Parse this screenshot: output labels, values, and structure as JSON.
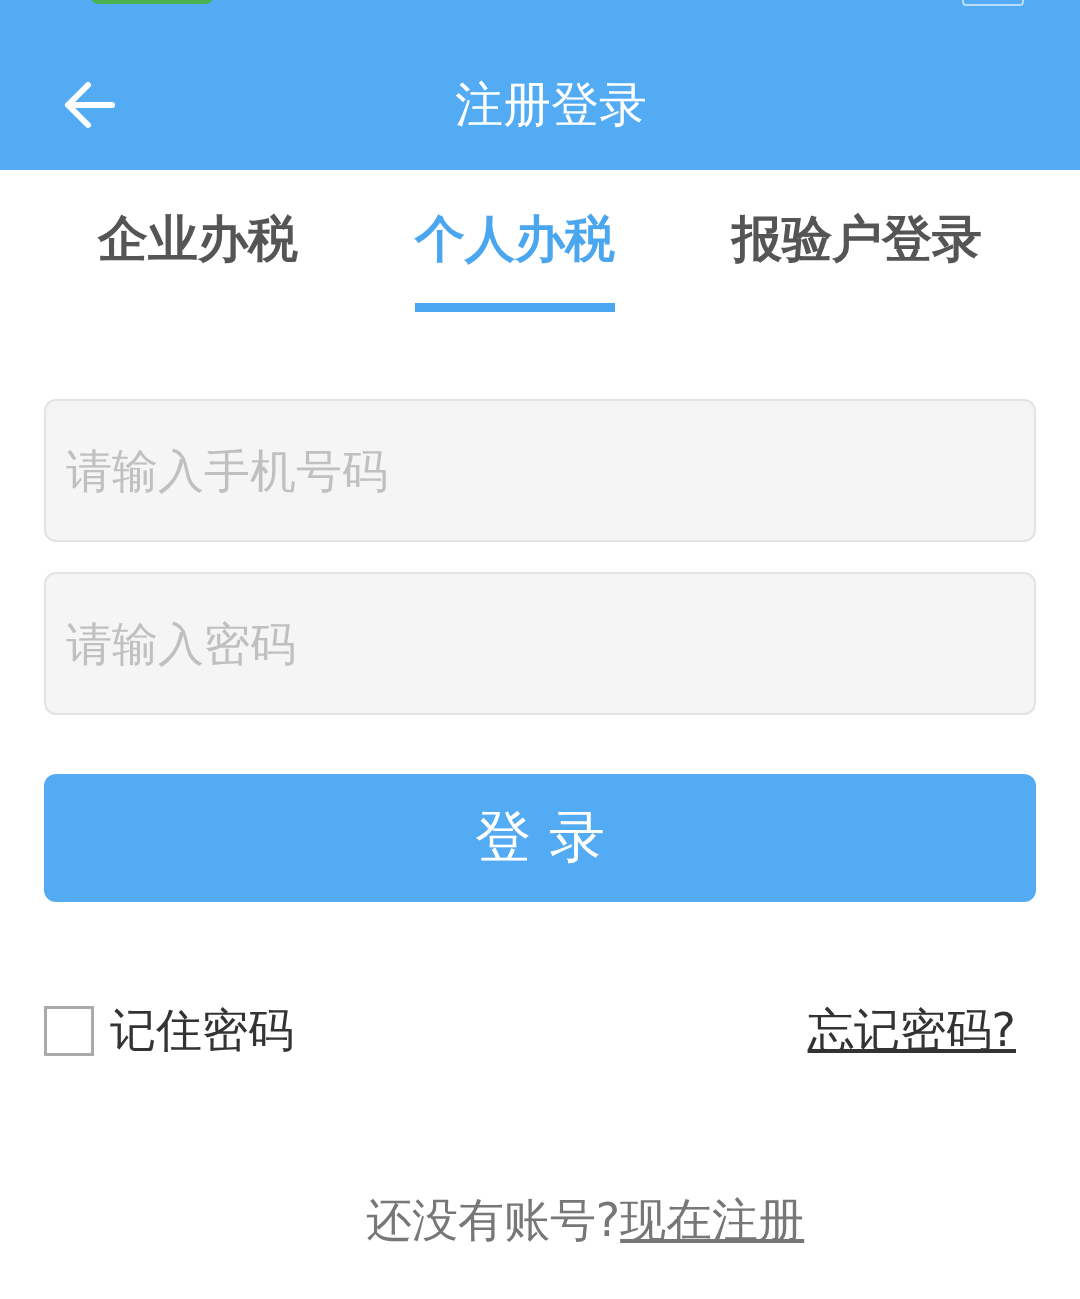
{
  "header": {
    "title": "注册登录"
  },
  "tabs": [
    {
      "label": "企业办税",
      "selected": false
    },
    {
      "label": "个人办税",
      "selected": true
    },
    {
      "label": "报验户登录",
      "selected": false
    }
  ],
  "fields": [
    {
      "placeholder": "请输入手机号码"
    },
    {
      "placeholder": "请输入密码"
    }
  ],
  "login_button": {
    "label": "登 录"
  },
  "remember": {
    "label": "记住密码",
    "checked": false
  },
  "forgot_link": "忘记密码?",
  "register": {
    "text": "还没有账号?",
    "link": "现在注册"
  }
}
